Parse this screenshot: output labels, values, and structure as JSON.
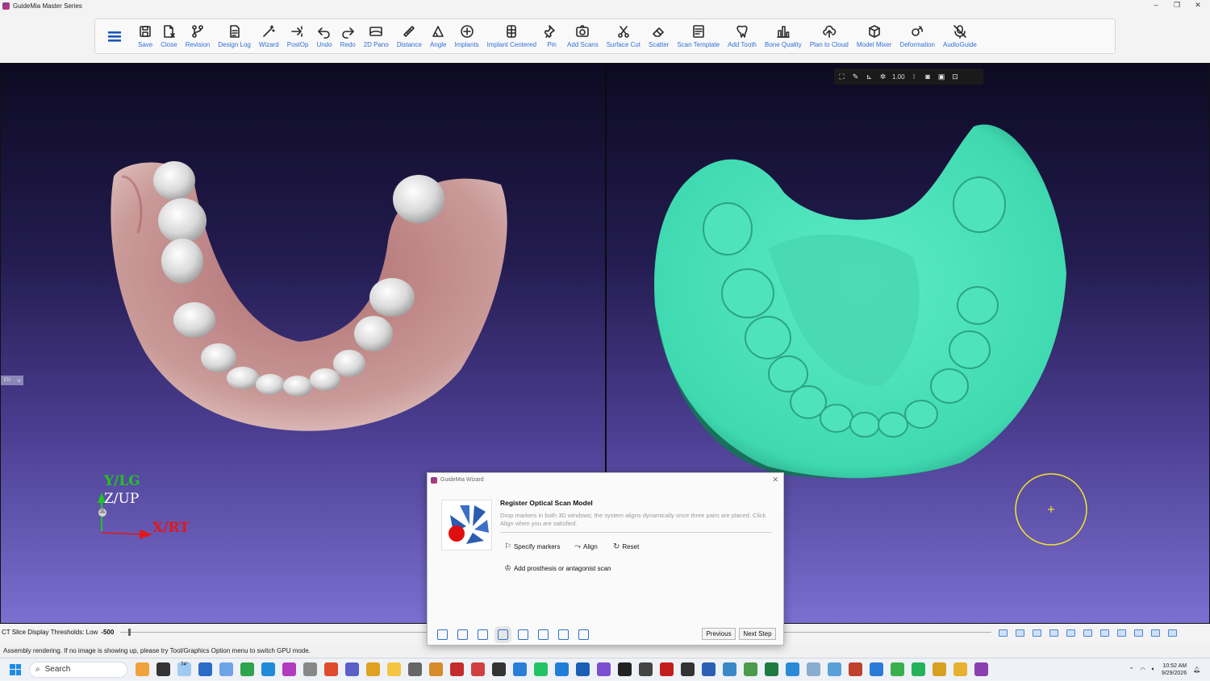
{
  "window": {
    "title": "GuideMia Master Series"
  },
  "toolbar": {
    "items": [
      {
        "label": "Save",
        "icon": "save-icon"
      },
      {
        "label": "Close",
        "icon": "close-file-icon"
      },
      {
        "label": "Revision",
        "icon": "revision-icon"
      },
      {
        "label": "Design Log",
        "icon": "design-log-icon"
      },
      {
        "label": "Wizard",
        "icon": "wizard-wand-icon"
      },
      {
        "label": "PostOp",
        "icon": "postop-icon"
      },
      {
        "label": "Undo",
        "icon": "undo-icon"
      },
      {
        "label": "Redo",
        "icon": "redo-icon"
      },
      {
        "label": "2D Pano",
        "icon": "pano-icon"
      },
      {
        "label": "Distance",
        "icon": "ruler-icon"
      },
      {
        "label": "Angle",
        "icon": "angle-icon"
      },
      {
        "label": "Implants",
        "icon": "implants-icon"
      },
      {
        "label": "Implant Centered",
        "icon": "implant-centered-icon"
      },
      {
        "label": "Pin",
        "icon": "pin-icon"
      },
      {
        "label": "Add Scans",
        "icon": "add-scans-icon"
      },
      {
        "label": "Surface Cut",
        "icon": "scissors-icon"
      },
      {
        "label": "Scatter",
        "icon": "eraser-icon"
      },
      {
        "label": "Scan Template",
        "icon": "scan-template-icon"
      },
      {
        "label": "Add Tooth",
        "icon": "tooth-icon"
      },
      {
        "label": "Bone Quality",
        "icon": "bar-chart-icon"
      },
      {
        "label": "Plan to Cloud",
        "icon": "cloud-upload-icon"
      },
      {
        "label": "Model Mixer",
        "icon": "cube-icon"
      },
      {
        "label": "Deformation",
        "icon": "deformation-icon"
      },
      {
        "label": "AudioGuide",
        "icon": "microphone-off-icon"
      }
    ]
  },
  "viewport_left": {
    "axis_y": "Y/LG",
    "axis_z": "Z/UP",
    "axis_x": "X/RT",
    "side_tab": "EN"
  },
  "viewport_right": {
    "zoom": "1.00",
    "mesh_color": "#40e0b8",
    "cursor_color": "#f2e62a"
  },
  "status": {
    "threshold_label": "CT Slice Display Thresholds: Low",
    "threshold_value": "-500",
    "message": "Assembly rendering. If no image is showing up, please try Tool/Graphics Option menu to switch GPU mode."
  },
  "wizard": {
    "title": "GuideMia Wizard",
    "heading": "Register Optical Scan Model",
    "description": "Drop markers in both 3D windows; the system aligns dynamically once three pairs are placed. Click Align when you are satisfied.",
    "actions": {
      "specify": "Specify markers",
      "align": "Align",
      "reset": "Reset",
      "add_prosthesis": "Add prosthesis or antagonist scan"
    },
    "previous": "Previous",
    "next": "Next Step"
  },
  "taskbar": {
    "search_placeholder": "Search",
    "weather": "74°",
    "time": "10:52 AM",
    "date": "9/29/2026"
  },
  "colors": {
    "accent": "#2f6fd6",
    "axis_x": "#e01818",
    "axis_y": "#22c422",
    "bone": "#c99a98"
  }
}
